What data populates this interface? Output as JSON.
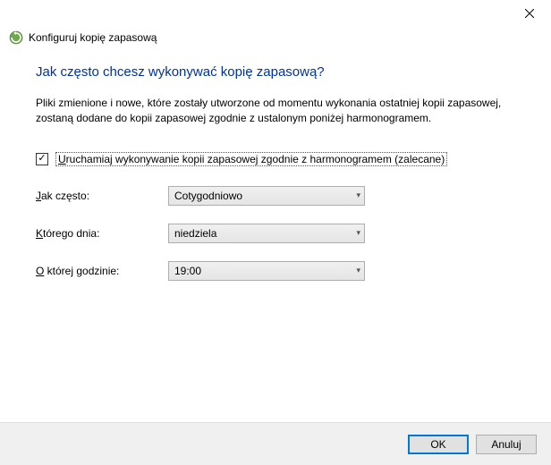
{
  "window": {
    "title": "Konfiguruj kopię zapasową"
  },
  "heading": "Jak często chcesz wykonywać kopię zapasową?",
  "description": "Pliki zmienione i nowe, które zostały utworzone od momentu wykonania ostatniej kopii zapasowej, zostaną dodane do kopii zapasowej zgodnie z ustalonym poniżej harmonogramem.",
  "checkbox": {
    "checked": true,
    "checkmark": "✓",
    "label": "Uruchamiaj wykonywanie kopii zapasowej zgodnie z harmonogramem (zalecane)"
  },
  "fields": {
    "frequency": {
      "label": "Jak często:",
      "value": "Cotygodniowo"
    },
    "day": {
      "label": "Którego dnia:",
      "value": "niedziela"
    },
    "time": {
      "label": "O której godzinie:",
      "value": "19:00"
    }
  },
  "buttons": {
    "ok": "OK",
    "cancel": "Anuluj"
  }
}
